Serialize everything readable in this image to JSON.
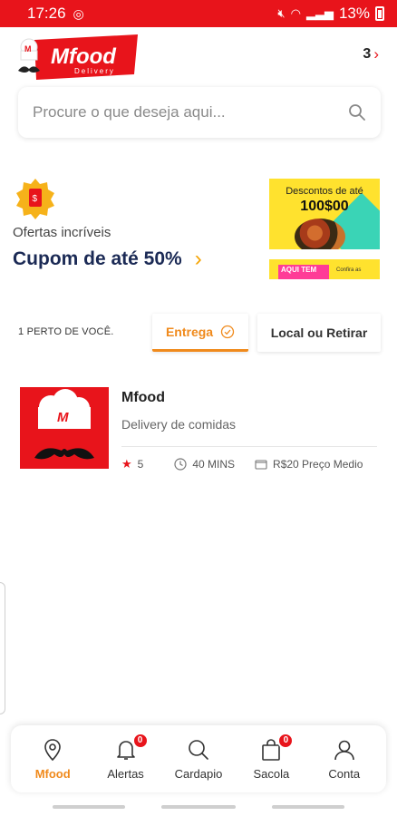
{
  "status_bar": {
    "time": "17:26",
    "battery_percent": "13%"
  },
  "header": {
    "logo_text": "Mfood",
    "logo_subtext": "Delivery",
    "logo_mark": "M",
    "count": "3"
  },
  "search": {
    "placeholder": "Procure o que deseja aqui..."
  },
  "banner": {
    "offer_label": "Ofertas incríveis",
    "offer_title": "Cupom de até 50%",
    "promo_top_line1": "Descontos de até",
    "promo_top_line2": "100$00",
    "promo_bottom_tag": "AQUI TEM",
    "promo_bottom_note": "Confira as"
  },
  "filters": {
    "near_label": "1 PERTO DE VOCÊ.",
    "tab_delivery": "Entrega",
    "tab_pickup": "Local ou Retirar"
  },
  "restaurant": {
    "name": "Mfood",
    "description": "Delivery de comidas",
    "rating": "5",
    "time": "40 MINS",
    "price": "R$20 Preço Medio"
  },
  "bottom_nav": [
    {
      "label": "Mfood",
      "icon": "location-pin-icon",
      "active": true
    },
    {
      "label": "Alertas",
      "icon": "bell-icon",
      "badge": "0"
    },
    {
      "label": "Cardapio",
      "icon": "search-icon"
    },
    {
      "label": "Sacola",
      "icon": "bag-icon",
      "badge": "0"
    },
    {
      "label": "Conta",
      "icon": "user-icon"
    }
  ],
  "colors": {
    "brand_red": "#e8141b",
    "accent_orange": "#f08a1c",
    "navy": "#1b2a55"
  }
}
